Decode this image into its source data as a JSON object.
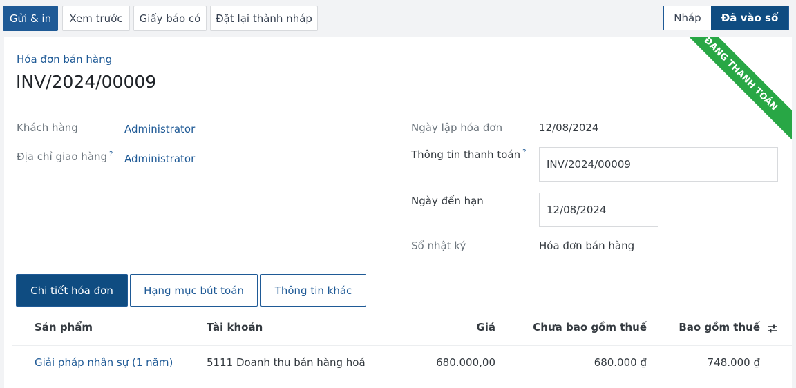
{
  "toolbar": {
    "send_print": "Gửi & in",
    "preview": "Xem trước",
    "credit_note": "Giấy báo có",
    "reset_draft": "Đặt lại thành nháp"
  },
  "status": {
    "draft": "Nháp",
    "posted": "Đã vào sổ"
  },
  "ribbon": "ĐANG THANH TOÁN",
  "invoice": {
    "type": "Hóa đơn bán hàng",
    "name": "INV/2024/00009"
  },
  "fields": {
    "customer_label": "Khách hàng",
    "customer_value": "Administrator",
    "delivery_label": "Địa chỉ giao hàng",
    "delivery_value": "Administrator",
    "help_mark": "?",
    "invoice_date_label": "Ngày lập hóa đơn",
    "invoice_date_value": "12/08/2024",
    "payment_ref_label": "Thông tin thanh toán",
    "payment_ref_value": "INV/2024/00009",
    "due_date_label": "Ngày đến hạn",
    "due_date_value": "12/08/2024",
    "journal_label": "Sổ nhật ký",
    "journal_value": "Hóa đơn bán hàng"
  },
  "tabs": [
    {
      "label": "Chi tiết hóa đơn"
    },
    {
      "label": "Hạng mục bút toán"
    },
    {
      "label": "Thông tin khác"
    }
  ],
  "table": {
    "headers": {
      "product": "Sản phẩm",
      "account": "Tài khoản",
      "price": "Giá",
      "subtotal": "Chưa bao gồm thuế",
      "total": "Bao gồm thuế"
    },
    "rows": [
      {
        "product": "Giải pháp nhân sự (1 năm)",
        "account": "5111 Doanh thu bán hàng hoá",
        "price": "680.000,00",
        "subtotal": "680.000 ₫",
        "total": "748.000 ₫"
      }
    ]
  },
  "icons": {
    "optional_columns": "sliders-icon"
  },
  "colors": {
    "primary": "#1f5a96",
    "primary_dark": "#0f4c81",
    "ribbon": "#28a745"
  }
}
